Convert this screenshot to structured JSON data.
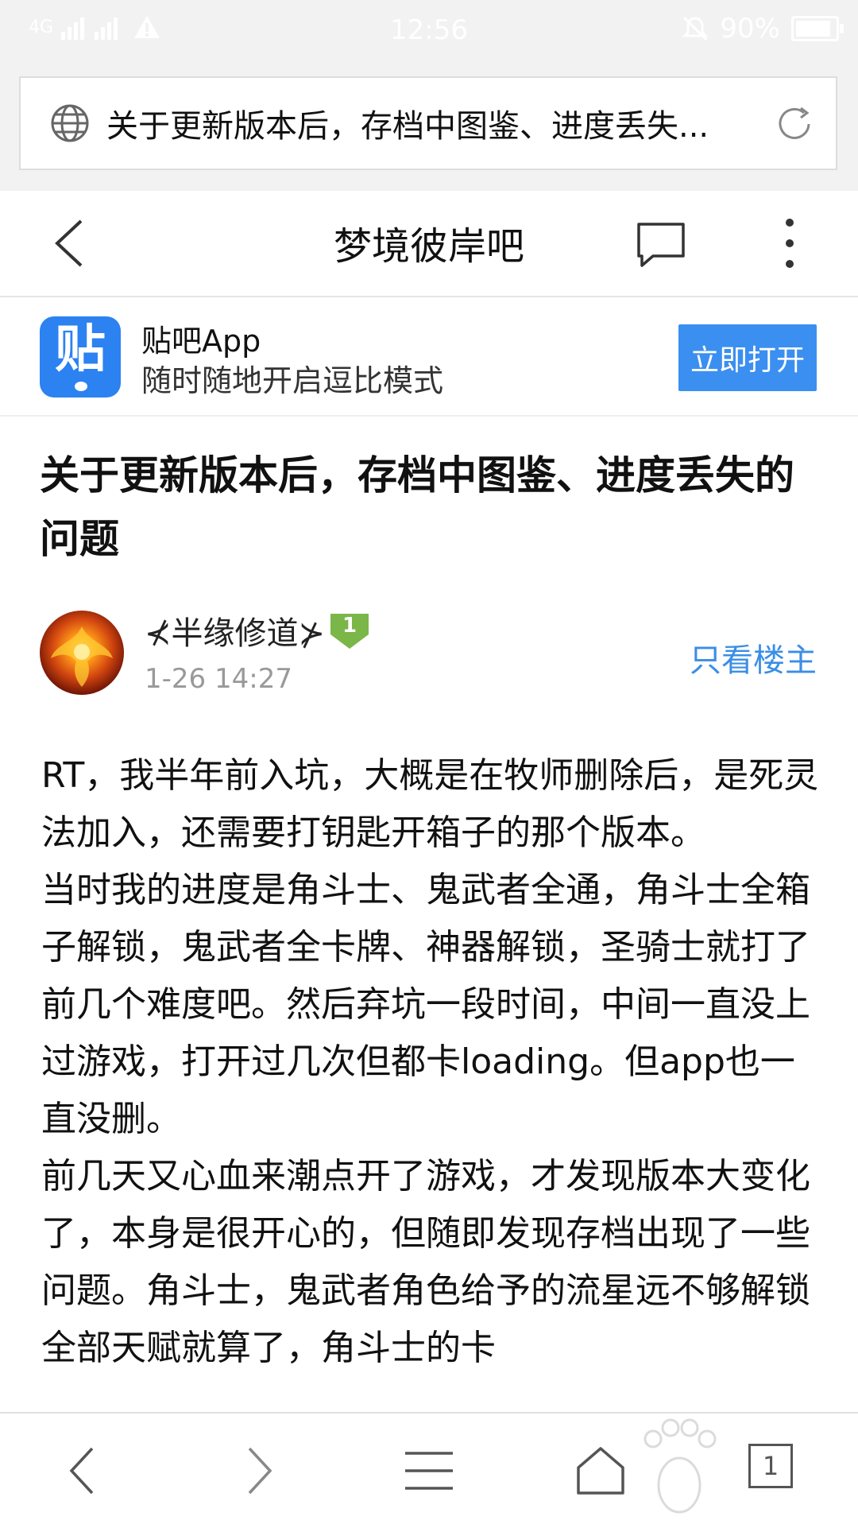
{
  "status_bar": {
    "network": "4G",
    "time": "12:56",
    "battery": "90%",
    "battery_level": 0.9,
    "icons": [
      "signal-icon",
      "warning-icon",
      "mute-icon",
      "battery-icon"
    ]
  },
  "url_bar": {
    "text": "关于更新版本后，存档中图鉴、进度丢失...",
    "icons": [
      "globe-icon",
      "reload-icon"
    ]
  },
  "nav": {
    "title": "梦境彼岸吧",
    "icons": [
      "back-arrow-icon",
      "comment-icon",
      "more-vertical-icon"
    ]
  },
  "app_banner": {
    "logo_text": "贴",
    "name": "贴吧App",
    "tagline": "随时随地开启逗比模式",
    "button": "立即打开"
  },
  "post": {
    "title": "关于更新版本后，存档中图鉴、进度丢失的问题",
    "author": "⊀半缘修道⊁",
    "level": "1",
    "time": "1-26 14:27",
    "only_op": "只看楼主",
    "paragraphs": [
      "RT，我半年前入坑，大概是在牧师删除后，是死灵法加入，还需要打钥匙开箱子的那个版本。",
      "当时我的进度是角斗士、鬼武者全通，角斗士全箱子解锁，鬼武者全卡牌、神器解锁，圣骑士就打了前几个难度吧。然后弃坑一段时间，中间一直没上过游戏，打开过几次但都卡loading。但app也一直没删。",
      "前几天又心血来潮点开了游戏，才发现版本大变化了，本身是很开心的，但随即发现存档出现了一些问题。角斗士，鬼武者角色给予的流星远不够解锁全部天赋就算了，角斗士的卡"
    ]
  },
  "bottom_bar": {
    "tab_count": "1",
    "icons": [
      "back-icon",
      "forward-icon",
      "menu-icon",
      "home-icon",
      "tabs-icon"
    ]
  }
}
